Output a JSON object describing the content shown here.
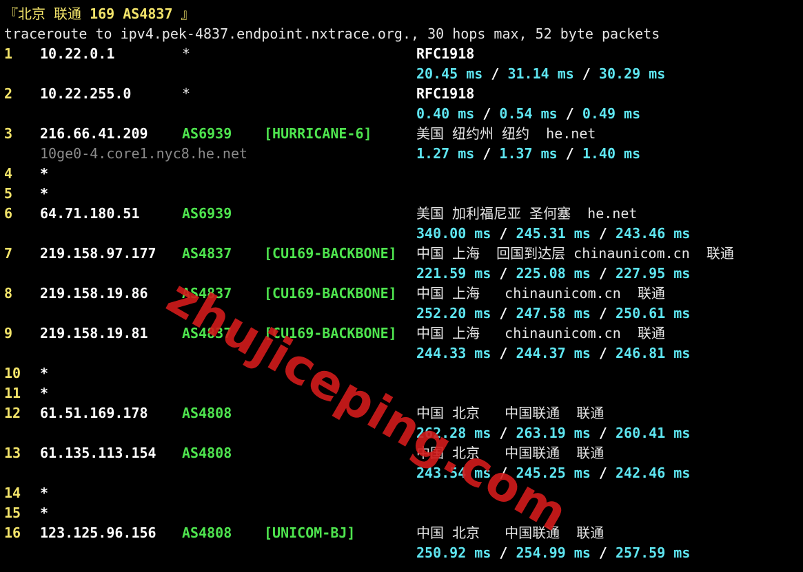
{
  "header": {
    "prefix": "『北京 联通 ",
    "title": "169 AS4837",
    "suffix": " 』"
  },
  "command": "traceroute to ipv4.pek-4837.endpoint.nxtrace.org., 30 hops max, 52 byte packets",
  "hops": [
    {
      "num": "1",
      "ip": "10.22.0.1",
      "second": "*",
      "geo": "RFC1918",
      "rtt": [
        "20.45 ms",
        "31.14 ms",
        "30.29 ms"
      ]
    },
    {
      "num": "2",
      "ip": "10.22.255.0",
      "second": "*",
      "geo": "RFC1918",
      "rtt": [
        "0.40 ms",
        "0.54 ms",
        "0.49 ms"
      ]
    },
    {
      "num": "3",
      "ip": "216.66.41.209",
      "asn": "AS6939",
      "tag": "[HURRICANE-6]",
      "geo": "美国 纽约州 纽约  he.net",
      "host": "10ge0-4.core1.nyc8.he.net",
      "rtt": [
        "1.27 ms",
        "1.37 ms",
        "1.40 ms"
      ]
    },
    {
      "num": "4",
      "star": "*"
    },
    {
      "num": "5",
      "star": "*"
    },
    {
      "num": "6",
      "ip": "64.71.180.51",
      "asn": "AS6939",
      "geo": "美国 加利福尼亚 圣何塞  he.net",
      "rtt": [
        "340.00 ms",
        "245.31 ms",
        "243.46 ms"
      ]
    },
    {
      "num": "7",
      "ip": "219.158.97.177",
      "asn": "AS4837",
      "tag": "[CU169-BACKBONE]",
      "geo": "中国 上海  回国到达层 chinaunicom.cn  联通",
      "rtt": [
        "221.59 ms",
        "225.08 ms",
        "227.95 ms"
      ]
    },
    {
      "num": "8",
      "ip": "219.158.19.86",
      "asn": "AS4837",
      "tag": "[CU169-BACKBONE]",
      "geo": "中国 上海   chinaunicom.cn  联通",
      "rtt": [
        "252.20 ms",
        "247.58 ms",
        "250.61 ms"
      ]
    },
    {
      "num": "9",
      "ip": "219.158.19.81",
      "asn": "AS4837",
      "tag": "[CU169-BACKBONE]",
      "geo": "中国 上海   chinaunicom.cn  联通",
      "rtt": [
        "244.33 ms",
        "244.37 ms",
        "246.81 ms"
      ]
    },
    {
      "num": "10",
      "star": "*"
    },
    {
      "num": "11",
      "star": "*"
    },
    {
      "num": "12",
      "ip": "61.51.169.178",
      "asn": "AS4808",
      "geo": "中国 北京   中国联通  联通",
      "rtt": [
        "262.28 ms",
        "263.19 ms",
        "260.41 ms"
      ]
    },
    {
      "num": "13",
      "ip": "61.135.113.154",
      "asn": "AS4808",
      "geo": "中国 北京   中国联通  联通",
      "rtt": [
        "243.54 ms",
        "245.25 ms",
        "242.46 ms"
      ]
    },
    {
      "num": "14",
      "star": "*"
    },
    {
      "num": "15",
      "star": "*"
    },
    {
      "num": "16",
      "ip": "123.125.96.156",
      "asn": "AS4808",
      "tag": "[UNICOM-BJ]",
      "geo": "中国 北京   中国联通  联通",
      "rtt": [
        "250.92 ms",
        "254.99 ms",
        "257.59 ms"
      ]
    }
  ],
  "rtt_separator": " / ",
  "watermark": "zhujiceping.com",
  "colors": {
    "background": "#000000",
    "hop_number": "#f3e46a",
    "ip": "#ffffff",
    "asn": "#4ee44e",
    "rtt": "#5ee5f0",
    "hostname": "#8a8a8a",
    "watermark": "#d21b1b"
  }
}
